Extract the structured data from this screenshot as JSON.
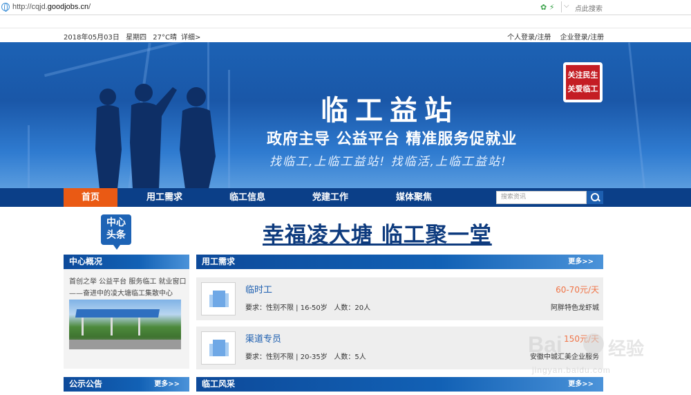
{
  "browser": {
    "url_prefix": "http://cqjd.",
    "url_domain": "goodjobs.cn",
    "url_suffix": "/",
    "search_label": "点此搜索"
  },
  "topbar": {
    "date": "2018年05月03日",
    "weekday": "星期四",
    "weather": "27°C晴",
    "detail": "详细>",
    "personal": "个人登录/注册",
    "company": "企业登录/注册"
  },
  "banner": {
    "title": "临工益站",
    "subtitle": "政府主导 公益平台 精准服务促就业",
    "slogan": "找临工,上临工益站! 找临活,上临工益站!",
    "stamp_line1": "关注民生",
    "stamp_line2": "关爱临工"
  },
  "nav": {
    "items": [
      "首页",
      "用工需求",
      "临工信息",
      "党建工作",
      "媒体聚焦"
    ],
    "search_placeholder": "搜索资讯",
    "active_index": 0
  },
  "headline": {
    "icon_line1": "中心",
    "icon_line2": "头条",
    "text": "幸福凌大塘 临工聚一堂"
  },
  "sections": {
    "center": {
      "title": "中心概况",
      "text": "首创之举 公益平台 服务临工 就业窗口——奋进中的凌大塘临工集散中心"
    },
    "demand": {
      "title": "用工需求",
      "more": "更多>>"
    },
    "notice": {
      "title": "公示公告",
      "more": "更多>>"
    },
    "style": {
      "title": "临工风采",
      "more": "更多>>"
    }
  },
  "jobs": [
    {
      "title": "临时工",
      "req": "要求：性别不限 | 16-50岁",
      "count": "人数：20人",
      "pay": "60-70元/天",
      "company": "阿胖特色龙虾城"
    },
    {
      "title": "渠道专员",
      "req": "要求：性别不限 | 20-35岁",
      "count": "人数：5人",
      "pay": "150元/天",
      "company": "安徽中城汇美企业服务"
    }
  ],
  "watermark": {
    "brand": "Bai",
    "brand_cn": "经验",
    "site": "jingyan.baidu.com"
  },
  "colors": {
    "nav_bg": "#0b3f88",
    "active": "#ea5a14",
    "accent": "#1d5fb0",
    "pay": "#f07447"
  }
}
